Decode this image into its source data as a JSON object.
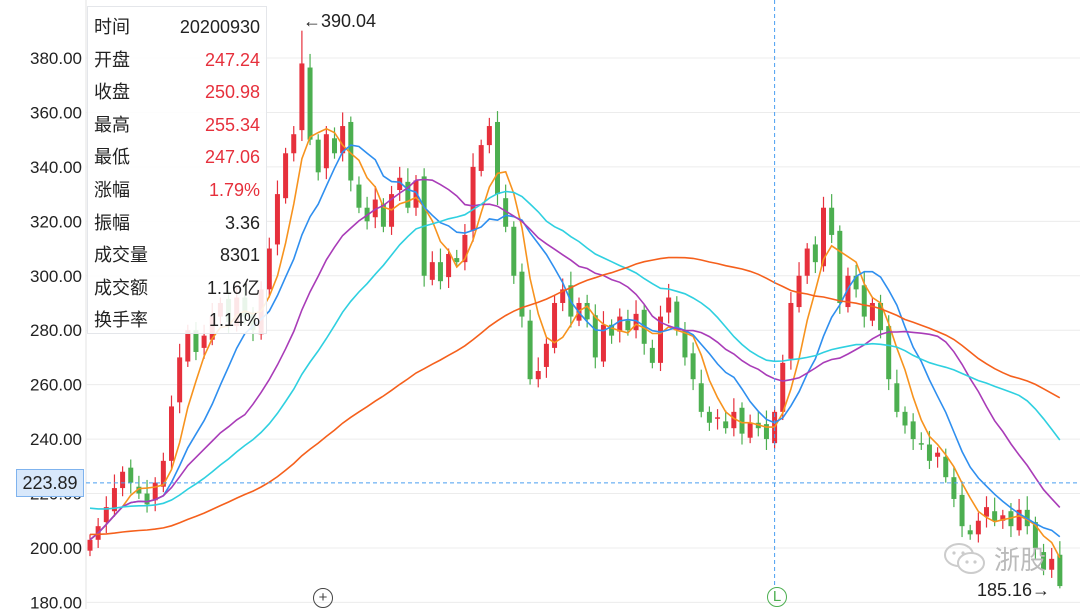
{
  "info_panel": {
    "rows": [
      {
        "label": "时间",
        "value": "20200930",
        "red": false
      },
      {
        "label": "开盘",
        "value": "247.24",
        "red": true
      },
      {
        "label": "收盘",
        "value": "250.98",
        "red": true
      },
      {
        "label": "最高",
        "value": "255.34",
        "red": true
      },
      {
        "label": "最低",
        "value": "247.06",
        "red": true
      },
      {
        "label": "涨幅",
        "value": "1.79%",
        "red": true
      },
      {
        "label": "振幅",
        "value": "3.36",
        "red": false
      },
      {
        "label": "成交量",
        "value": "8301",
        "red": false
      },
      {
        "label": "成交额",
        "value": "1.16亿",
        "red": false
      },
      {
        "label": "换手率",
        "value": "1.14%",
        "red": false
      }
    ]
  },
  "crosshair": {
    "price_label": "223.89",
    "price": 223.89,
    "candle_index": 84
  },
  "annotations": {
    "high_label": "←390.04",
    "high": 390.04,
    "high_index": 26,
    "low_label": "185.16→",
    "low": 185.16,
    "low_index": 119
  },
  "markers": {
    "plus": "+",
    "l": "L"
  },
  "watermark": {
    "text": "浙股",
    "icon": "wechat-icon"
  },
  "colors": {
    "up": "#e6303c",
    "down": "#4caf50",
    "ma5": "#f7931e",
    "ma10": "#2f8fef",
    "ma20": "#a93cb8",
    "ma30": "#2fd0e0",
    "ma60": "#f5601c",
    "crosshair": "#4a9ff0"
  },
  "chart_data": {
    "type": "candlestick",
    "ylim": [
      180,
      392
    ],
    "yticks": [
      "180.00",
      "200.00",
      "220.00",
      "240.00",
      "260.00",
      "280.00",
      "300.00",
      "320.00",
      "340.00",
      "360.00",
      "380.00"
    ],
    "grid": true,
    "moving_averages": [
      5,
      10,
      20,
      30,
      60
    ],
    "close": [
      203,
      208,
      215,
      222,
      228,
      224,
      220,
      216,
      224,
      232,
      252,
      270,
      280,
      272,
      278,
      285,
      290,
      283,
      292,
      285,
      280,
      295,
      310,
      330,
      345,
      352,
      378,
      350,
      338,
      352,
      345,
      355,
      335,
      325,
      320,
      328,
      318,
      330,
      336,
      325,
      335,
      300,
      305,
      298,
      308,
      305,
      315,
      340,
      348,
      355,
      330,
      318,
      300,
      285,
      262,
      265,
      275,
      290,
      295,
      285,
      290,
      284,
      270,
      282,
      278,
      285,
      280,
      286,
      275,
      268,
      285,
      292,
      280,
      270,
      262,
      250,
      246,
      248,
      244,
      250,
      242,
      246,
      244,
      240,
      250,
      268,
      290,
      300,
      310,
      305,
      325,
      315,
      290,
      300,
      295,
      285,
      290,
      280,
      262,
      250,
      245,
      240,
      238,
      232,
      235,
      226,
      218,
      208,
      205,
      210,
      215,
      210,
      212,
      208,
      214,
      208,
      200,
      192,
      196,
      186
    ]
  }
}
